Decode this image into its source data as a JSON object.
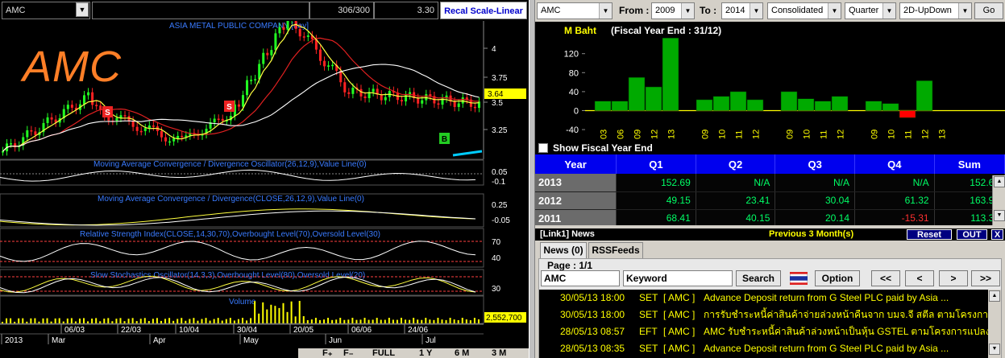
{
  "chart_panel": {
    "symbol_value": "AMC",
    "dropdown_icon": "chevron-down-icon",
    "ratio": "306/300",
    "last_price": "3.30",
    "recal_label": "Recal Scale-Linear",
    "big_symbol": "AMC",
    "title": "ASIA METAL PUBLIC COMPANY [day]",
    "price_axis": [
      "4",
      "3.75",
      "3.5",
      "3.25"
    ],
    "current_price_tag": "3.64",
    "signal_sell": "S",
    "signal_buy": "B",
    "macd_osc_label": "Moving Average Convergence / Divergence Oscillator(26,12,9),Value Line(0)",
    "macd_osc_axis": [
      "0.05",
      "-0.1"
    ],
    "macd_label": "Moving Average Convergence / Divergence(CLOSE,26,12,9),Value Line(0)",
    "macd_axis": [
      "0.25",
      "-0.05"
    ],
    "rsi_label": "Relative Strength Index(CLOSE,14,30,70),Overbought Level(70),Oversold Level(30)",
    "rsi_axis": [
      "70",
      "40"
    ],
    "stoch_label": "Slow Stochastics Oscillator(14,3,3),Overbought Level(80),Oversold Level(20)",
    "stoch_axis": [
      "30"
    ],
    "volume_label": "Volume",
    "volume_value": "2,552,700",
    "date_ticks": [
      "06/03",
      "22/03",
      "10/04",
      "30/04",
      "20/05",
      "06/06",
      "24/06"
    ],
    "month_ticks": [
      "2013",
      "Mar",
      "Apr",
      "May",
      "Jun",
      "Jul"
    ],
    "range_buttons": [
      "FULL",
      "1 Y",
      "6 M",
      "3 M"
    ]
  },
  "financials": {
    "symbol": "AMC",
    "from_label": "From :",
    "from_value": "2009",
    "to_label": "To :",
    "to_value": "2014",
    "consolidation": "Consolidated",
    "period": "Quarter",
    "chart_style": "2D-UpDown",
    "go_label": "Go",
    "chart_title_unit": "M Baht",
    "chart_title_fy": "(Fiscal Year End : 31/12)",
    "show_fy_label": "Show Fiscal Year End",
    "table_headers": [
      "Year",
      "Q1",
      "Q2",
      "Q3",
      "Q4",
      "Sum"
    ],
    "table_rows": [
      {
        "year": "2013",
        "q1": "152.69",
        "q2": "N/A",
        "q3": "N/A",
        "q4": "N/A",
        "sum": "152.69"
      },
      {
        "year": "2012",
        "q1": "49.15",
        "q2": "23.41",
        "q3": "30.04",
        "q4": "61.32",
        "sum": "163.92"
      },
      {
        "year": "2011",
        "q1": "68.41",
        "q2": "40.15",
        "q3": "20.14",
        "q4": "-15.31",
        "sum": "113.37"
      }
    ]
  },
  "chart_data": {
    "type": "bar",
    "title": "M Baht",
    "subtitle": "(Fiscal Year End : 31/12)",
    "ylim": [
      -50,
      150
    ],
    "y_ticks": [
      120,
      80,
      40,
      0,
      -40
    ],
    "categories": [
      "03",
      "06",
      "09",
      "12",
      "13",
      "",
      "09",
      "10",
      "11",
      "12",
      "",
      "09",
      "10",
      "11",
      "12",
      "",
      "09",
      "10",
      "11",
      "12",
      "13"
    ],
    "values": [
      20,
      20,
      70,
      50,
      153,
      null,
      23,
      30,
      40,
      23,
      null,
      40,
      25,
      20,
      30,
      null,
      20,
      15,
      -15,
      63,
      null
    ],
    "bar_color_pos": "#00aa00",
    "bar_color_neg": "#ff0000",
    "zero_line_color": "#ffff00"
  },
  "news": {
    "header_label": "[Link1] News",
    "previous_label": "Previous 3 Month(s)",
    "reset_label": "Reset",
    "out_label": "OUT",
    "x_label": "X",
    "tab_news": "News (0)",
    "tab_rss": "RSSFeeds",
    "page_label": "Page : 1/1",
    "symbol_input": "AMC",
    "keyword_placeholder": "Keyword",
    "search_label": "Search",
    "option_label": "Option",
    "nav_first": "<<",
    "nav_prev": "<",
    "nav_next": ">",
    "nav_last": ">>",
    "items": [
      {
        "date": "30/05/13 18:00",
        "source": "SET",
        "symbol": "[ AMC ]",
        "text": "Advance Deposit return from G Steel PLC paid by Asia ..."
      },
      {
        "date": "30/05/13 18:00",
        "source": "SET",
        "symbol": "[ AMC ]",
        "text": "การรับชำระหนี้ค่าสินค้าจ่ายล่วงหน้าคืนจาก บมจ.จี สตีล ตามโครงการแปล..."
      },
      {
        "date": "28/05/13 08:57",
        "source": "EFT",
        "symbol": "[ AMC ]",
        "text": "AMC รับชำระหนี้ค่าสินค้าล่วงหน้าเป็นหุ้น GSTEL ตามโครงการแปลง..."
      },
      {
        "date": "28/05/13 08:35",
        "source": "SET",
        "symbol": "[ AMC ]",
        "text": "Advance Deposit return from G Steel PLC paid by Asia ..."
      }
    ]
  }
}
